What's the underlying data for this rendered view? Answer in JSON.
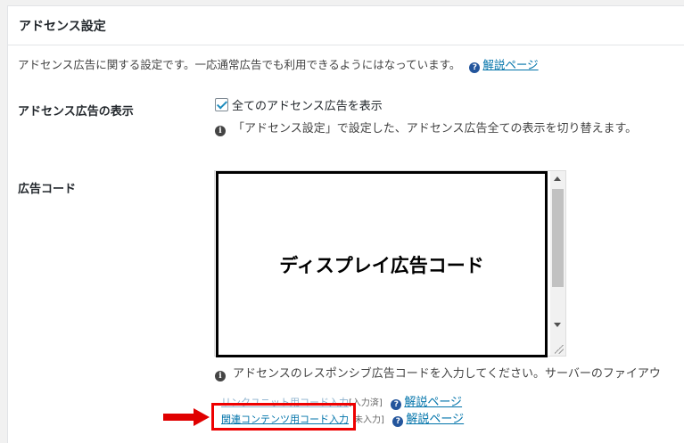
{
  "panel": {
    "title": "アドセンス設定",
    "description": "アドセンス広告に関する設定です。一応通常広告でも利用できるようにはなっています。",
    "help_link": "解説ページ"
  },
  "display_setting": {
    "label": "アドセンス広告の表示",
    "checkbox_label": "全てのアドセンス広告を表示",
    "checked": true,
    "note": "「アドセンス設定」で設定した、アドセンス広告全ての表示を切り替えます。"
  },
  "ad_code": {
    "label": "広告コード",
    "textarea_value": "ディスプレイ広告コード",
    "note": "アドセンスのレスポンシブ広告コードを入力してください。サーバーのファイアウ",
    "links": [
      {
        "label": "リンクユニット用コード入力",
        "status": "[入力済]",
        "help": "解説ページ"
      },
      {
        "label": "関連コンテンツ用コード入力",
        "status": "未入力]",
        "help": "解説ページ"
      }
    ]
  },
  "colors": {
    "link": "#0073aa",
    "highlight": "#e00000",
    "arrow": "#e00000"
  }
}
